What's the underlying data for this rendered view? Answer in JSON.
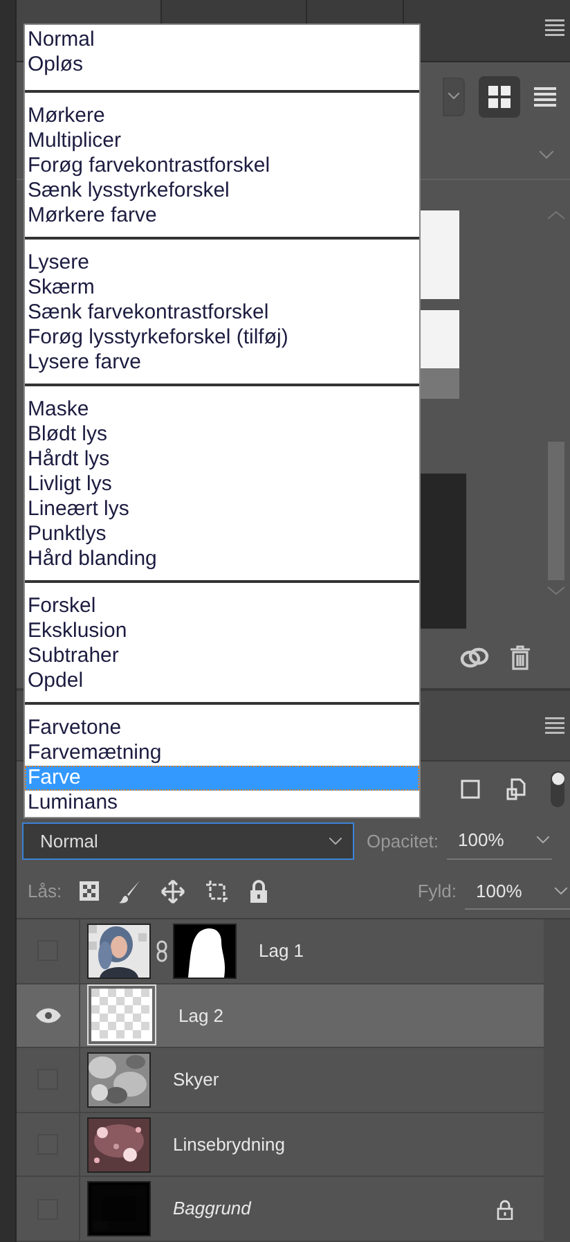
{
  "blend_menu": {
    "groups": [
      [
        {
          "label": "Normal",
          "selected": false
        },
        {
          "label": "Opløs",
          "selected": false
        }
      ],
      [
        {
          "label": "Mørkere",
          "selected": false
        },
        {
          "label": "Multiplicer",
          "selected": false
        },
        {
          "label": "Forøg farvekontrastforskel",
          "selected": false
        },
        {
          "label": "Sænk lysstyrkeforskel",
          "selected": false
        },
        {
          "label": "Mørkere farve",
          "selected": false
        }
      ],
      [
        {
          "label": "Lysere",
          "selected": false
        },
        {
          "label": "Skærm",
          "selected": false
        },
        {
          "label": "Sænk farvekontrastforskel",
          "selected": false
        },
        {
          "label": "Forøg lysstyrkeforskel (tilføj)",
          "selected": false
        },
        {
          "label": "Lysere farve",
          "selected": false
        }
      ],
      [
        {
          "label": "Maske",
          "selected": false
        },
        {
          "label": "Blødt lys",
          "selected": false
        },
        {
          "label": "Hårdt lys",
          "selected": false
        },
        {
          "label": "Livligt lys",
          "selected": false
        },
        {
          "label": "Lineært lys",
          "selected": false
        },
        {
          "label": "Punktlys",
          "selected": false
        },
        {
          "label": "Hård blanding",
          "selected": false
        }
      ],
      [
        {
          "label": "Forskel",
          "selected": false
        },
        {
          "label": "Eksklusion",
          "selected": false
        },
        {
          "label": "Subtraher",
          "selected": false
        },
        {
          "label": "Opdel",
          "selected": false
        }
      ],
      [
        {
          "label": "Farvetone",
          "selected": false
        },
        {
          "label": "Farvemætning",
          "selected": false
        },
        {
          "label": "Farve",
          "selected": true
        },
        {
          "label": "Luminans",
          "selected": false
        }
      ]
    ]
  },
  "layers_panel": {
    "blend_mode": "Normal",
    "opacity_label": "Opacitet:",
    "opacity": "100%",
    "lock_label": "Lås:",
    "fill_label": "Fyld:",
    "fill": "100%",
    "layers": [
      {
        "name": "Lag 1",
        "visible": false,
        "selected": false,
        "mask": true,
        "background": false
      },
      {
        "name": "Lag 2",
        "visible": true,
        "selected": true,
        "mask": false,
        "background": false
      },
      {
        "name": "Skyer",
        "visible": false,
        "selected": false,
        "mask": false,
        "background": false
      },
      {
        "name": "Linsebrydning",
        "visible": false,
        "selected": false,
        "mask": false,
        "background": false
      },
      {
        "name": "Baggrund",
        "visible": false,
        "selected": false,
        "mask": false,
        "background": true
      }
    ]
  }
}
